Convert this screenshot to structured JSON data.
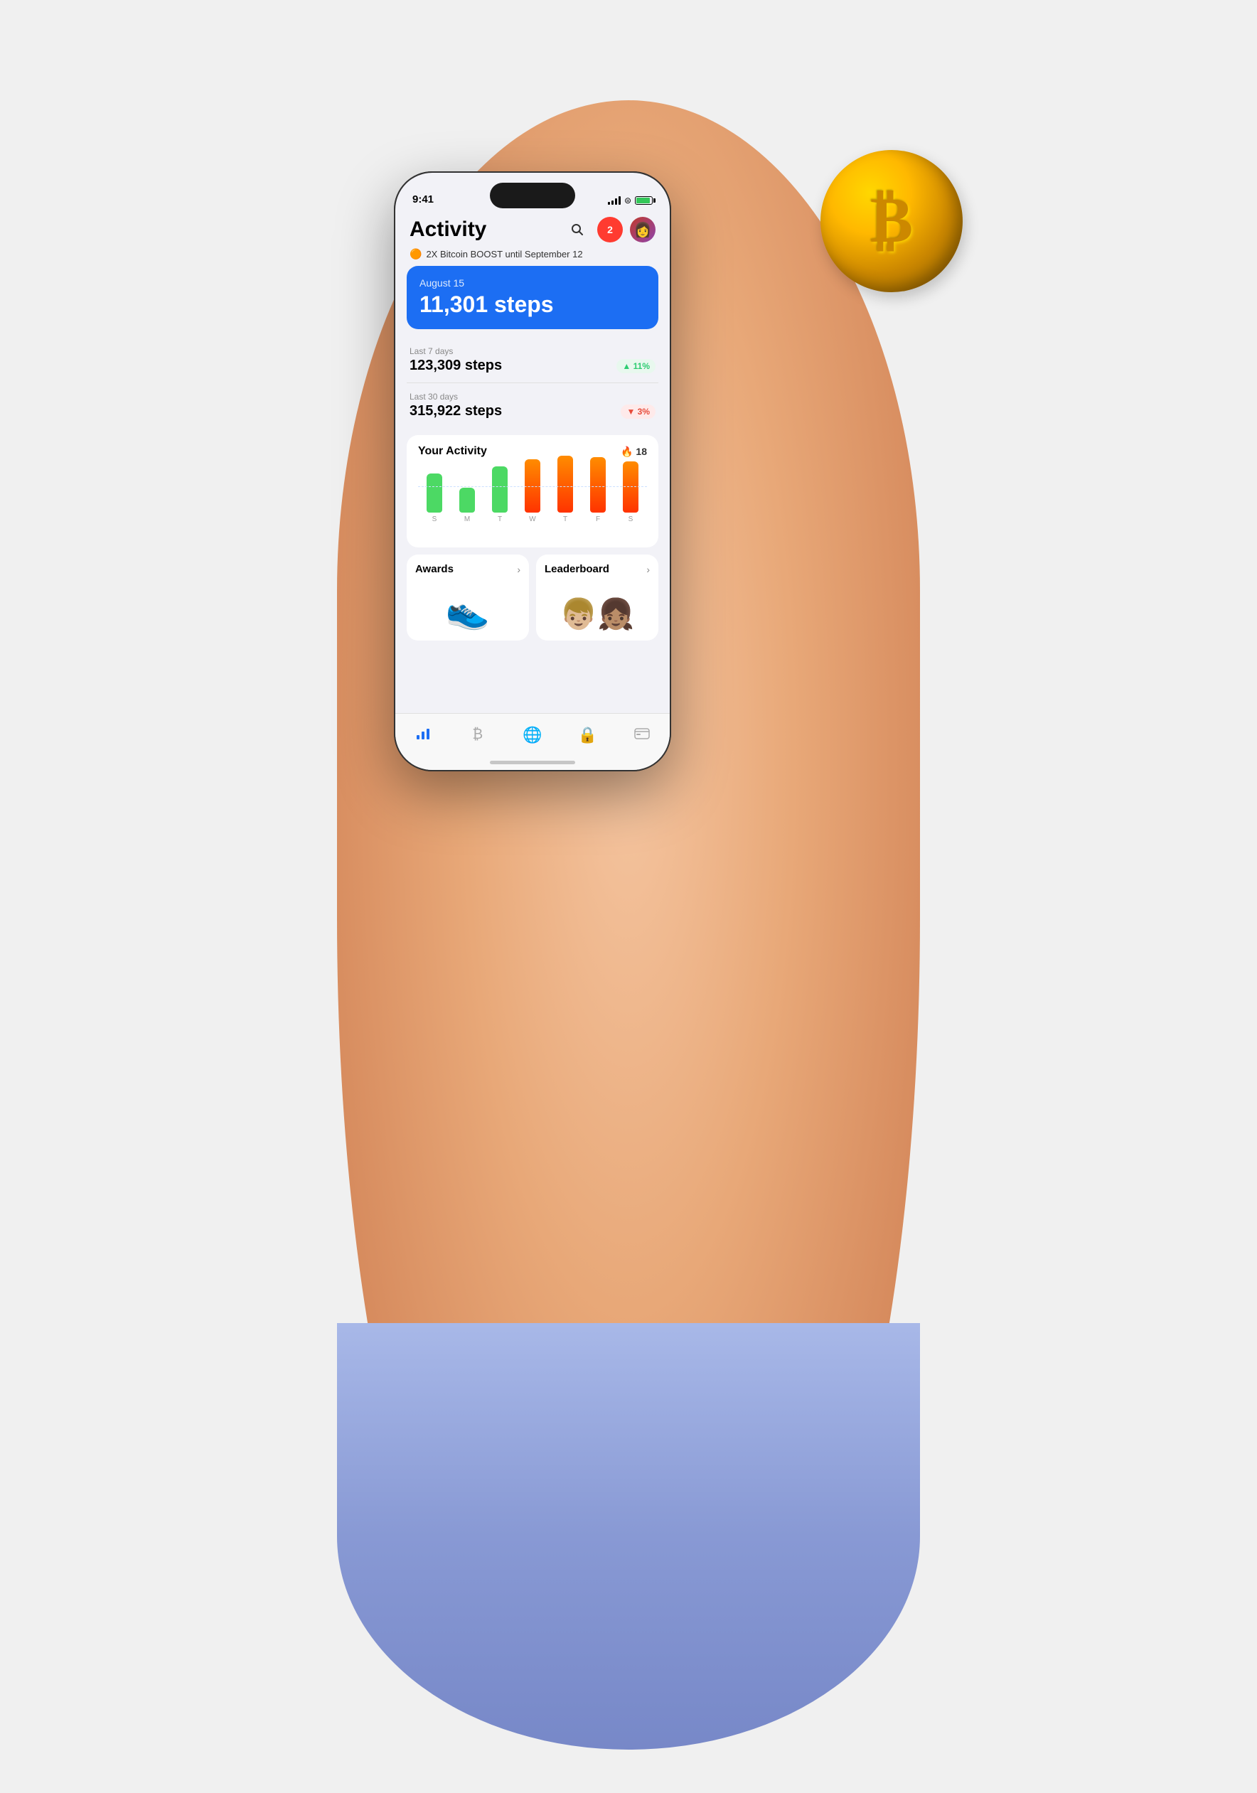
{
  "scene": {
    "background_color": "#f0f0f0"
  },
  "status_bar": {
    "time": "9:41",
    "battery_level": 99
  },
  "header": {
    "title": "Activity",
    "notification_count": "2"
  },
  "boost_banner": {
    "text": "2X Bitcoin BOOST until September 12"
  },
  "today_card": {
    "date_label": "August 15",
    "steps": "11,301 steps"
  },
  "stats": [
    {
      "label": "Last 7 days",
      "value": "123,309 steps",
      "badge": "▲ 11%",
      "badge_type": "up"
    },
    {
      "label": "Last 30 days",
      "value": "315,922 steps",
      "badge": "▼ 3%",
      "badge_type": "down"
    }
  ],
  "activity_section": {
    "title": "Your Activity",
    "streak": "18",
    "chart": {
      "bars": [
        {
          "day": "S",
          "height": 55,
          "color": "#4cd964"
        },
        {
          "day": "M",
          "height": 35,
          "color": "#4cd964"
        },
        {
          "day": "T",
          "height": 65,
          "color": "#4cd964"
        },
        {
          "day": "W",
          "height": 75,
          "color": "#ff6b35"
        },
        {
          "day": "T",
          "height": 80,
          "color": "#ff6b35"
        },
        {
          "day": "F",
          "height": 78,
          "color": "#ff6b35"
        },
        {
          "day": "S",
          "height": 72,
          "color": "#ff6b35"
        }
      ]
    }
  },
  "awards_card": {
    "title": "Awards",
    "arrow": "›"
  },
  "leaderboard_card": {
    "title": "Leaderboard",
    "arrow": "›"
  },
  "tab_bar": {
    "tabs": [
      {
        "icon": "chart",
        "active": true
      },
      {
        "icon": "bitcoin",
        "active": false
      },
      {
        "icon": "globe",
        "active": false
      },
      {
        "icon": "lock",
        "active": false
      },
      {
        "icon": "card",
        "active": false
      }
    ]
  }
}
